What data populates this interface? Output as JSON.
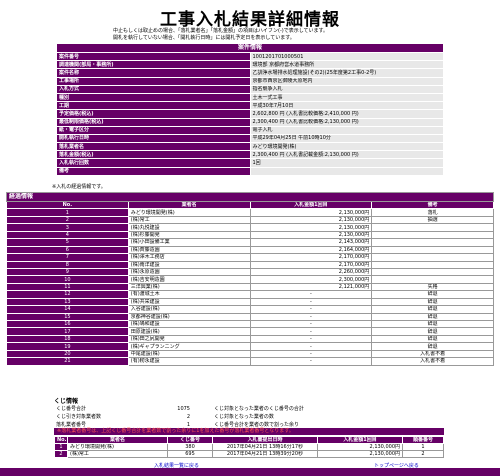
{
  "page": {
    "title": "工事入札結果詳細情報",
    "notes": [
      "中止もしくは取止めの場合、「落札業者名」「落札金額」の項目はハイフン(-)で表示しています。",
      "開札を執行していない場合、「開札執行日時」には開札予定日を表示しています。"
    ]
  },
  "detail": {
    "header": "案件情報",
    "rows": [
      {
        "label": "案件番号",
        "value": "1001201701000501"
      },
      {
        "label": "調達機関(部局・事務所)",
        "value": "環境部 京都府営水道事務所"
      },
      {
        "label": "案件名称",
        "value": "乙訓浄水場排水処理施設(その2)(25年度第2工事0-2号)"
      },
      {
        "label": "工事場所",
        "value": "京都市西京区御陵大原地内"
      },
      {
        "label": "入札方式",
        "value": "指名競争入札"
      },
      {
        "label": "種別",
        "value": "土木一式工事"
      },
      {
        "label": "工期",
        "value": "平成30年7月10日"
      },
      {
        "label": "予定価格(税込)",
        "value": "2,602,800 円 (入札書比較価格:2,410,000 円)"
      },
      {
        "label": "最低制限価格(税込)",
        "value": "2,300,400 円 (入札書比較価格:2,130,000 円)"
      },
      {
        "label": "紙・電子区分",
        "value": "電子入札"
      },
      {
        "label": "開札執行日時",
        "value": "平成29年04月25日 午前10時10分"
      },
      {
        "label": "落札業者名",
        "value": "みどり環境開発(株)"
      },
      {
        "label": "落札金額(税込)",
        "value": "2,300,400 円 (入札書記載金額:2,130,000 円)"
      },
      {
        "label": "入札執行回数",
        "value": "1回"
      },
      {
        "label": "備考",
        "value": ""
      }
    ]
  },
  "status": {
    "note": "※入札の経過情報です。",
    "section": "経過情報",
    "headers": {
      "no": "No.",
      "name": "業者名",
      "amount": "入札金額1回目",
      "remark": "備考"
    },
    "rows": [
      {
        "no": "1",
        "name": "みどり環境開発(株)",
        "amount": "2,130,000円",
        "remark": "落札"
      },
      {
        "no": "2",
        "name": "(株)常工",
        "amount": "2,130,000円",
        "remark": "抽選"
      },
      {
        "no": "3",
        "name": "(株)丸悦建設",
        "amount": "2,130,000円",
        "remark": ""
      },
      {
        "no": "4",
        "name": "(株)杉藤開発",
        "amount": "2,130,000円",
        "remark": ""
      },
      {
        "no": "5",
        "name": "(株)小田設備工業",
        "amount": "2,143,000円",
        "remark": ""
      },
      {
        "no": "6",
        "name": "(株)斉藤造園",
        "amount": "2,164,000円",
        "remark": ""
      },
      {
        "no": "7",
        "name": "(株)澤木工務店",
        "amount": "2,170,000円",
        "remark": ""
      },
      {
        "no": "8",
        "name": "(株)南洋建設",
        "amount": "2,170,000円",
        "remark": ""
      },
      {
        "no": "9",
        "name": "(株)永原造園",
        "amount": "2,260,000円",
        "remark": ""
      },
      {
        "no": "10",
        "name": "(株)吉安明造園",
        "amount": "2,300,000円",
        "remark": ""
      },
      {
        "no": "11",
        "name": "三洋興業(株)",
        "amount": "2,121,000円",
        "remark": "失格"
      },
      {
        "no": "12",
        "name": "(有)渡城土木",
        "amount": "-",
        "remark": "辞退"
      },
      {
        "no": "13",
        "name": "(株)共栄建設",
        "amount": "-",
        "remark": "辞退"
      },
      {
        "no": "14",
        "name": "入谷建設(株)",
        "amount": "-",
        "remark": "辞退"
      },
      {
        "no": "15",
        "name": "京都神谷建設(株)",
        "amount": "-",
        "remark": "辞退"
      },
      {
        "no": "16",
        "name": "(株)鳩和建設",
        "amount": "-",
        "remark": "辞退"
      },
      {
        "no": "17",
        "name": "田原建設(株)",
        "amount": "-",
        "remark": "辞退"
      },
      {
        "no": "18",
        "name": "(株)田之尻開発",
        "amount": "-",
        "remark": "辞退"
      },
      {
        "no": "19",
        "name": "(株)ギャプランニング",
        "amount": "-",
        "remark": "辞退"
      },
      {
        "no": "20",
        "name": "中尾建設(株)",
        "amount": "-",
        "remark": "入札書不着"
      },
      {
        "no": "21",
        "name": "(有)籾永建設",
        "amount": "-",
        "remark": "入札書不着"
      }
    ]
  },
  "kuji": {
    "title": "くじ情報",
    "info": [
      {
        "label": "くじ番号合計",
        "value": "1075",
        "label2": "くじ対象となった業者のくじ番号の合計",
        "value2": ""
      },
      {
        "label": "くじ引き対象業者数",
        "value": "2",
        "label2": "くじ対象となった業者の数",
        "value2": ""
      },
      {
        "label": "落札業者番号",
        "value": "1",
        "label2": "くじ番号合計を業者の数で割った余り",
        "value2": ""
      }
    ],
    "warning": "※落札業者番号は、上記くじ番号合計を業者数で割った余りに1を加えた番号が落札業者番号となります。",
    "headers": {
      "no": "No.",
      "name": "業者名",
      "kuji": "くじ番号",
      "time": "入札書提出日時",
      "amount": "入札金額1回目",
      "order": "順番番号"
    },
    "rows": [
      {
        "no": "1",
        "name": "みどり環境開発(株)",
        "kuji": "380",
        "time": "2017年04月21日 13時16分17秒",
        "amount": "2,130,000円",
        "order": "1"
      },
      {
        "no": "2",
        "name": "(株)常工",
        "kuji": "695",
        "time": "2017年04月21日 13時39分20秒",
        "amount": "2,130,000円",
        "order": "2"
      }
    ]
  },
  "nav": {
    "back": "入札結果一覧に戻る",
    "top": "トップページへ戻る"
  }
}
